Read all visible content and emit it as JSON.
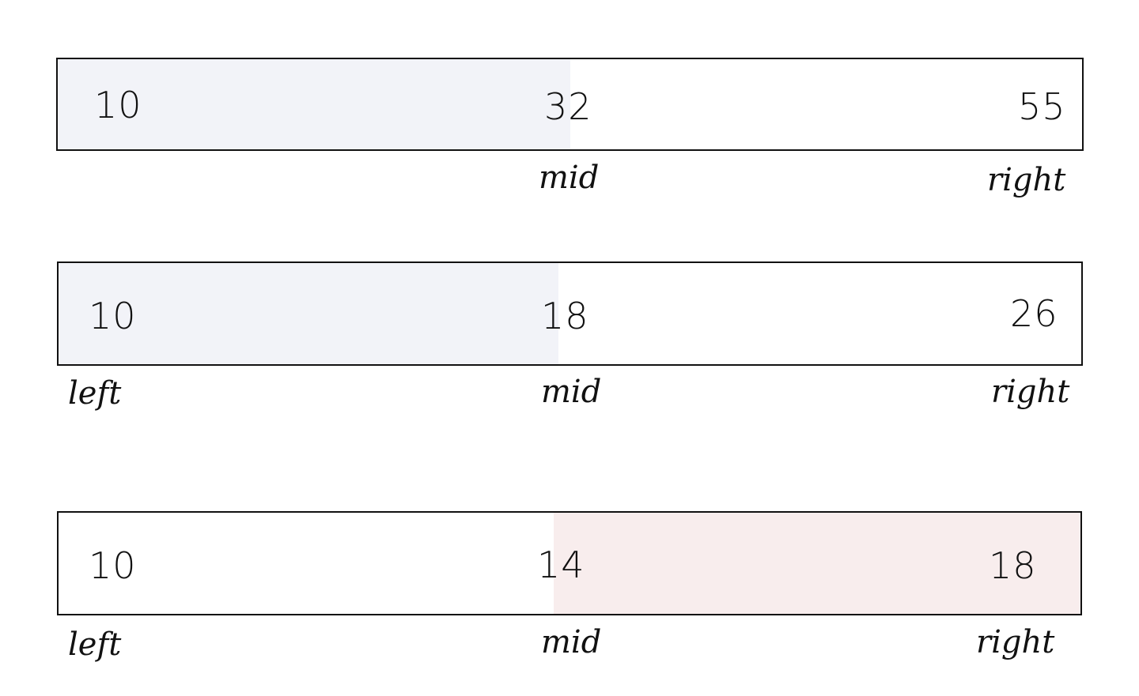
{
  "colors": {
    "border": "#111111",
    "shade_blue": "#f2f3f8",
    "shade_red": "#f8eded",
    "background": "#ffffff"
  },
  "rows": [
    {
      "left_value": "10",
      "mid_value": "32",
      "right_value": "55",
      "left_label": "",
      "mid_label": "mid",
      "right_label": "right",
      "shaded_side": "left",
      "shade": "blue"
    },
    {
      "left_value": "10",
      "mid_value": "18",
      "right_value": "26",
      "left_label": "left",
      "mid_label": "mid",
      "right_label": "right",
      "shaded_side": "left",
      "shade": "blue"
    },
    {
      "left_value": "10",
      "mid_value": "14",
      "right_value": "18",
      "left_label": "left",
      "mid_label": "mid",
      "right_label": "right",
      "shaded_side": "right",
      "shade": "red"
    }
  ]
}
